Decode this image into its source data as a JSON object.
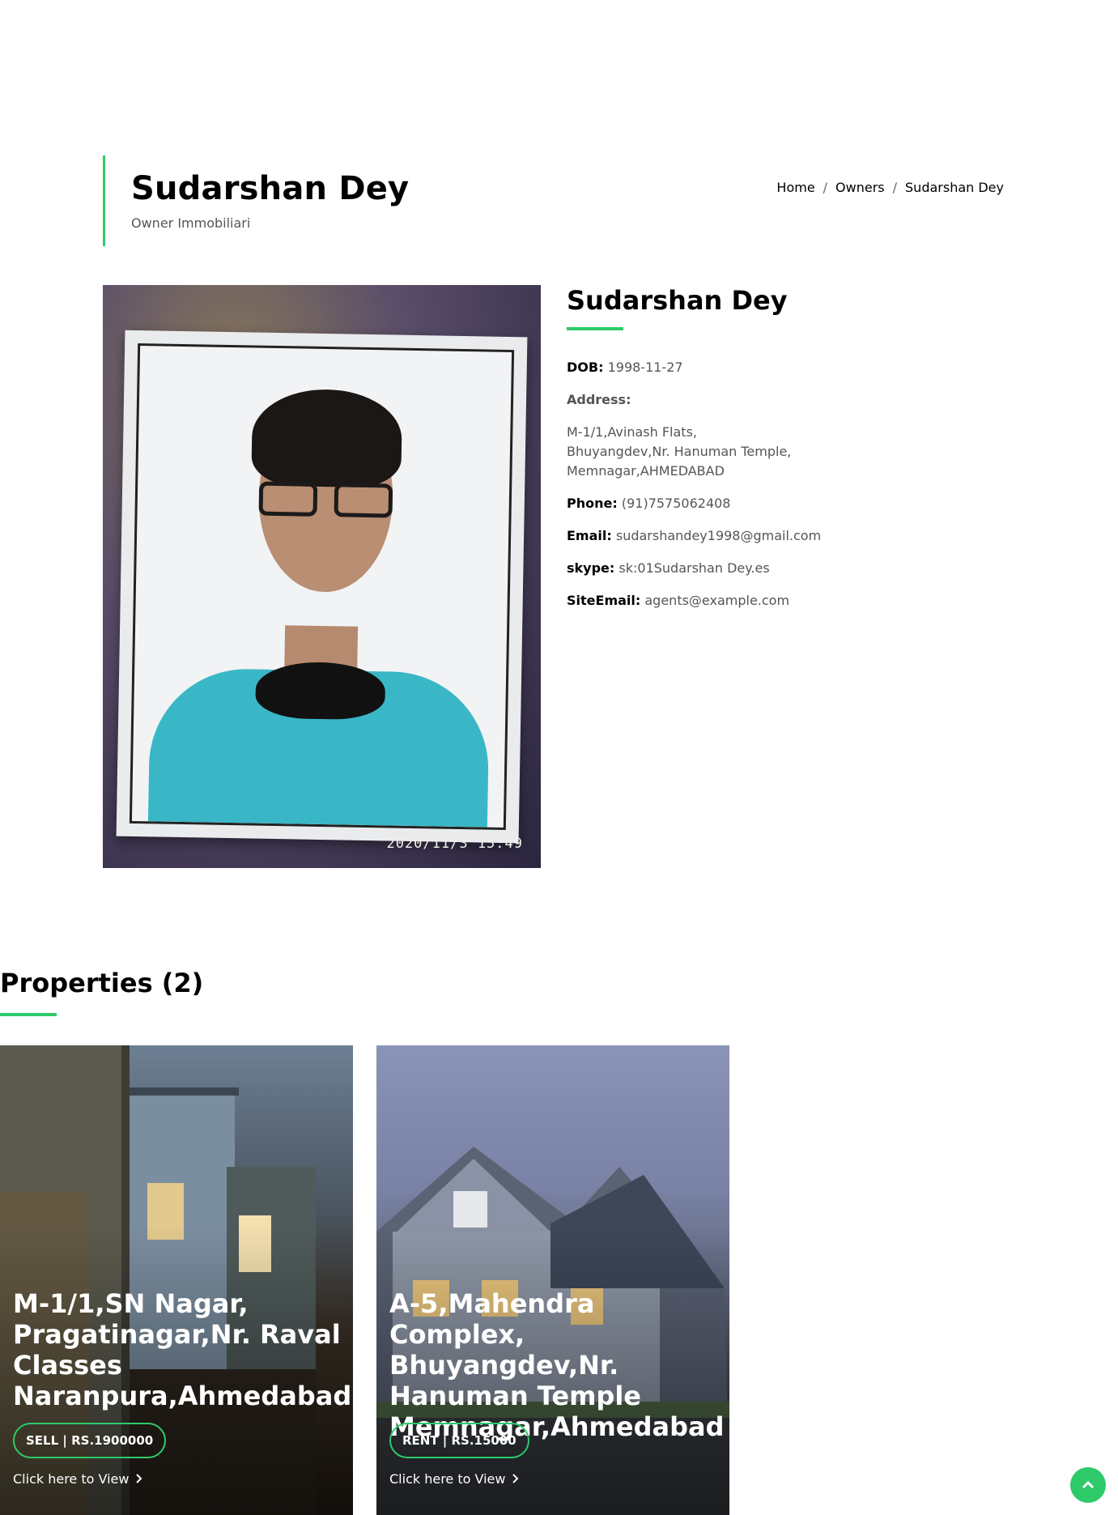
{
  "header": {
    "title": "Sudarshan Dey",
    "subtitle": "Owner Immobiliari",
    "breadcrumb": [
      "Home",
      "Owners",
      "Sudarshan Dey"
    ],
    "breadcrumb_sep": "/"
  },
  "photo": {
    "icon": "owner-photo",
    "timestamp": "2020/11/3  15:49"
  },
  "profile": {
    "name": "Sudarshan Dey",
    "dob_label": "DOB:",
    "dob": "1998-11-27",
    "address_label": "Address:",
    "address_lines": [
      "M-1/1,Avinash Flats,",
      "Bhuyangdev,Nr. Hanuman Temple,",
      "Memnagar,AHMEDABAD"
    ],
    "phone_label": "Phone:",
    "phone": "(91)7575062408",
    "email_label": "Email:",
    "email": "sudarshandey1998@gmail.com",
    "skype_label": "skype:",
    "skype": "sk:01Sudarshan Dey.es",
    "siteemail_label": "SiteEmail:",
    "siteemail": "agents@example.com"
  },
  "properties": {
    "heading": "Properties (2)",
    "items": [
      {
        "title": "M-1/1,SN Nagar, Pragatinagar,Nr. Raval Classes Naranpura,Ahmedabad",
        "badge": "SELL | RS.1900000",
        "link": "Click here to View"
      },
      {
        "title": "A-5,Mahendra Complex, Bhuyangdev,Nr. Hanuman Temple Memnagar,Ahmedabad",
        "badge": "RENT | RS.15000",
        "link": "Click here to View"
      }
    ]
  },
  "colors": {
    "accent": "#2eca6a"
  },
  "icons": {
    "scroll_top": "chevron-up-icon",
    "link_arrow": "chevron-right-icon"
  }
}
